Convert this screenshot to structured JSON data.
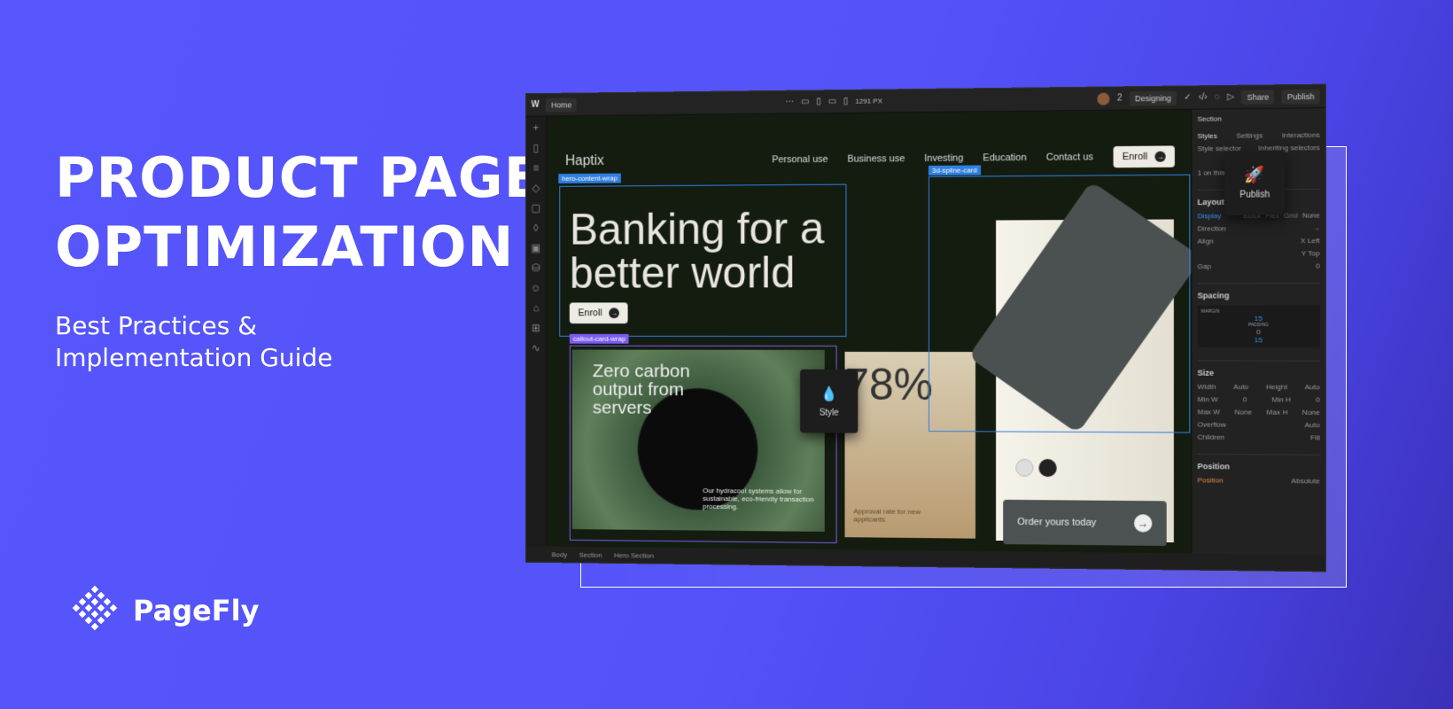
{
  "banner": {
    "title": "PRODUCT PAGE OPTIMIZATION",
    "subtitle": "Best Practices & Implementation Guide",
    "brand": "PageFly",
    "bg_color": "#5555fb"
  },
  "editor": {
    "topbar": {
      "page": "Home",
      "width": "1291 PX",
      "collaborators": "2",
      "mode": "Designing",
      "share": "Share",
      "publish": "Publish"
    },
    "site": {
      "brand": "Haptix",
      "nav": [
        "Personal use",
        "Business use",
        "Investing",
        "Education",
        "Contact us"
      ],
      "enroll": "Enroll",
      "hero": "Banking for a better world",
      "hero_enroll": "Enroll",
      "callout_title": "Zero carbon output from servers",
      "callout_body": "Our hydracool systems allow for sustainable, eco-friendly transaction processing.",
      "stat": "78%",
      "stat_label": "Approval rate for new applicants",
      "order": "Order yours today"
    },
    "labels": {
      "hero_wrap": "hero-content-wrap",
      "callout_wrap": "callout-card-wrap",
      "spline": "3d-spline-card"
    },
    "tooltips": {
      "style": "Style",
      "publish": "Publish"
    },
    "panel": {
      "element": "Section",
      "tabs": [
        "Styles",
        "Settings",
        "Interactions"
      ],
      "style_selector": "Style selector",
      "inheriting": "Inheriting selectors",
      "on_page": "1 on this page",
      "layout": "Layout",
      "display": "Display",
      "display_opts": [
        "Block",
        "Flex",
        "Grid",
        "None"
      ],
      "direction": "Direction",
      "align": "Align",
      "x": "X",
      "x_val": "Left",
      "y": "Y",
      "y_val": "Top",
      "gap": "Gap",
      "gap_val": "0",
      "spacing": "Spacing",
      "margin": "MARGIN",
      "padding": "PADDING",
      "margin_top": "15",
      "margin_bottom": "15",
      "pad_val": "0",
      "size": "Size",
      "width": "Width",
      "width_val": "Auto",
      "height": "Height",
      "height_val": "Auto",
      "min_w": "Min W",
      "min_h": "Min H",
      "max_w": "Max W",
      "max_h": "Max H",
      "zero": "0",
      "none": "None",
      "overflow": "Overflow",
      "overflow_auto": "Auto",
      "children": "Children",
      "children_val": "Fill",
      "position": "Position",
      "position_label": "Position",
      "position_val": "Absolute"
    },
    "breadcrumbs": [
      "Body",
      "Section",
      "Hero Section"
    ]
  }
}
